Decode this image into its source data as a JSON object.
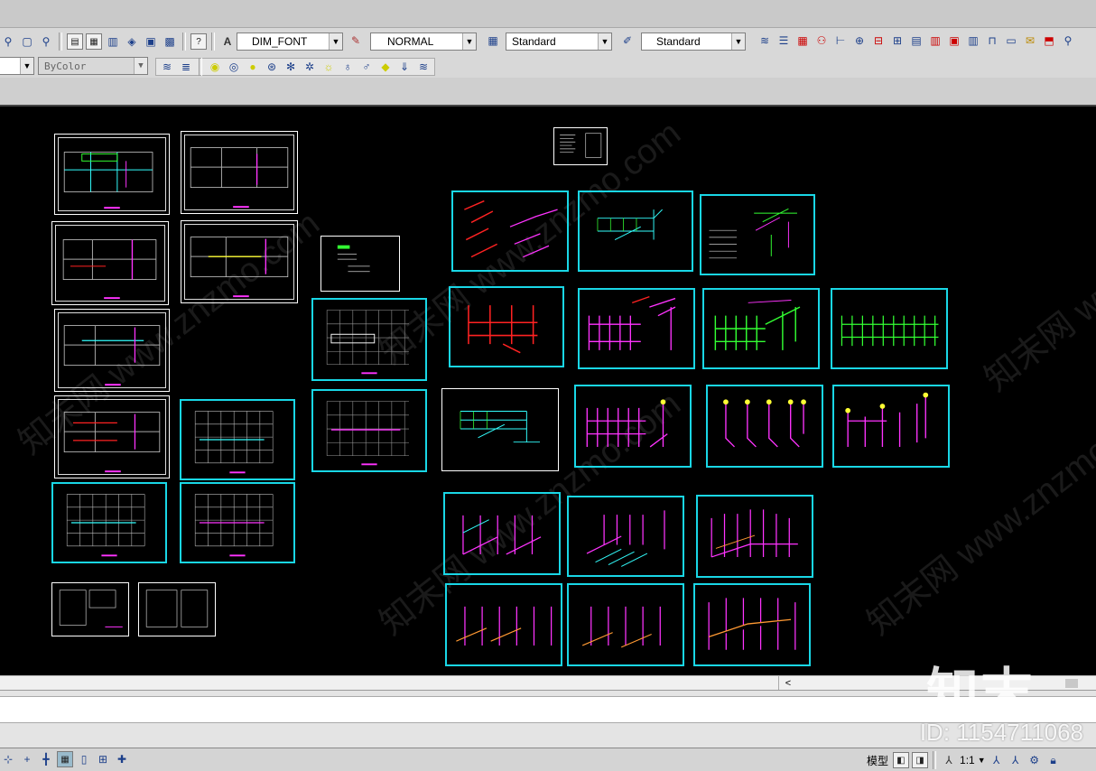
{
  "toolbar1": {
    "text_style": "DIM_FONT",
    "layer_state": "NORMAL",
    "table_style": "Standard",
    "multileader_style": "Standard"
  },
  "toolbar2": {
    "color_control": "ByColor"
  },
  "status": {
    "model_label": "模型",
    "scale_label": "1:1"
  },
  "watermark": {
    "logo": "知末",
    "id": "ID: 1154711068",
    "repeat": "知末网 www.znzmo.com"
  },
  "colors": {
    "sheet_border_cyan": "#19d7e6",
    "magenta": "#ff33ff",
    "green": "#33ff33",
    "red": "#ff2222",
    "yellow": "#ffff33",
    "cyan": "#33ffff"
  },
  "icons": {
    "text_style": "text-style-icon",
    "layer": "layer-icon",
    "table": "table-icon",
    "multileader": "multileader-icon"
  }
}
